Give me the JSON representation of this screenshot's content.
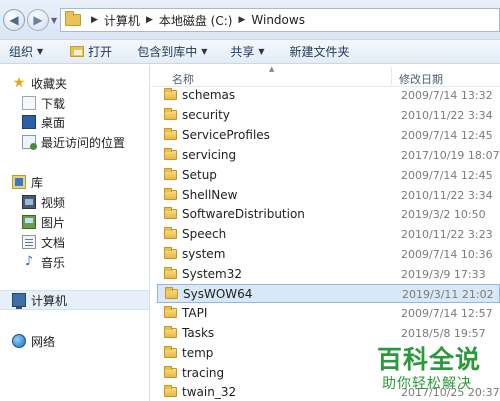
{
  "address_bar": {
    "breadcrumbs": [
      "计算机",
      "本地磁盘 (C:)",
      "Windows"
    ]
  },
  "toolbar": {
    "organize": "组织",
    "open": "打开",
    "include_in_library": "包含到库中",
    "share": "共享",
    "new_folder": "新建文件夹"
  },
  "nav_pane": {
    "favorites": "收藏夹",
    "downloads": "下载",
    "desktop": "桌面",
    "recent": "最近访问的位置",
    "libraries": "库",
    "videos": "视频",
    "pictures": "图片",
    "documents": "文档",
    "music": "音乐",
    "computer": "计算机",
    "network": "网络"
  },
  "file_list": {
    "columns": {
      "name": "名称",
      "date": "修改日期"
    },
    "rows": [
      {
        "name": "schemas",
        "date": "2009/7/14 13:32"
      },
      {
        "name": "security",
        "date": "2010/11/22 3:34"
      },
      {
        "name": "ServiceProfiles",
        "date": "2009/7/14 12:45"
      },
      {
        "name": "servicing",
        "date": "2017/10/19 18:07"
      },
      {
        "name": "Setup",
        "date": "2009/7/14 12:45"
      },
      {
        "name": "ShellNew",
        "date": "2010/11/22 3:34"
      },
      {
        "name": "SoftwareDistribution",
        "date": "2019/3/2 10:50"
      },
      {
        "name": "Speech",
        "date": "2010/11/22 3:23"
      },
      {
        "name": "system",
        "date": "2009/7/14 10:36"
      },
      {
        "name": "System32",
        "date": "2019/3/9 17:33"
      },
      {
        "name": "SysWOW64",
        "date": "2019/3/11 21:02"
      },
      {
        "name": "TAPI",
        "date": "2009/7/14 12:57"
      },
      {
        "name": "Tasks",
        "date": "2018/5/8 19:57"
      },
      {
        "name": "temp",
        "date": ""
      },
      {
        "name": "tracing",
        "date": ""
      },
      {
        "name": "twain_32",
        "date": "2017/10/25 20:37"
      }
    ]
  },
  "watermark": {
    "title": "百科全说",
    "subtitle": "助你轻松解决"
  }
}
